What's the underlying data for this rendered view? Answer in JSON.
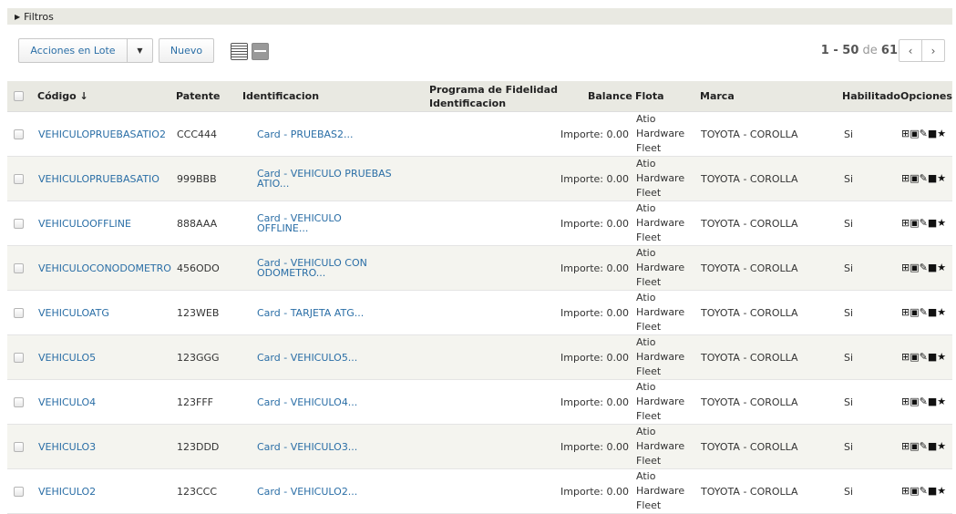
{
  "filters": {
    "label": "Filtros",
    "toggle_icon": "triangle-right-icon"
  },
  "toolbar": {
    "bulk_actions_label": "Acciones en Lote",
    "bulk_caret_icon": "caret-down-icon",
    "new_label": "Nuevo",
    "view_list_icon": "list-view-icon",
    "view_grid_icon": "grid-view-icon"
  },
  "pagination": {
    "range": "1 - 50",
    "of": "de",
    "total": "61",
    "prev_icon": "chevron-left-icon",
    "next_icon": "chevron-right-icon"
  },
  "table": {
    "headers": {
      "codigo": "Código ↓",
      "patente": "Patente",
      "identificacion": "Identificacion",
      "programa_line1": "Programa de Fidelidad",
      "programa_line2": "Identificacion",
      "balance": "Balance",
      "flota": "Flota",
      "marca": "Marca",
      "habilitado": "Habilitado",
      "opciones": "Opciones"
    },
    "rows": [
      {
        "codigo": "VEHICULOPRUEBASATIO2",
        "patente": "CCC444",
        "ident": "Card - PRUEBAS2...",
        "balance": "Importe: 0.00",
        "flota": [
          "Atio",
          "Hardware",
          "Fleet"
        ],
        "marca": "TOYOTA - COROLLA",
        "habilitado": "Si"
      },
      {
        "codigo": "VEHICULOPRUEBASATIO",
        "patente": "999BBB",
        "ident": "Card - VEHICULO PRUEBAS ATIO...",
        "balance": "Importe: 0.00",
        "flota": [
          "Atio",
          "Hardware",
          "Fleet"
        ],
        "marca": "TOYOTA - COROLLA",
        "habilitado": "Si"
      },
      {
        "codigo": "VEHICULOOFFLINE",
        "patente": "888AAA",
        "ident": "Card - VEHICULO OFFLINE...",
        "balance": "Importe: 0.00",
        "flota": [
          "Atio",
          "Hardware",
          "Fleet"
        ],
        "marca": "TOYOTA - COROLLA",
        "habilitado": "Si"
      },
      {
        "codigo": "VEHICULOCONODOMETRO",
        "patente": "456ODO",
        "ident": "Card - VEHICULO CON ODOMETRO...",
        "balance": "Importe: 0.00",
        "flota": [
          "Atio",
          "Hardware",
          "Fleet"
        ],
        "marca": "TOYOTA - COROLLA",
        "habilitado": "Si"
      },
      {
        "codigo": "VEHICULOATG",
        "patente": "123WEB",
        "ident": "Card - TARJETA ATG...",
        "balance": "Importe: 0.00",
        "flota": [
          "Atio",
          "Hardware",
          "Fleet"
        ],
        "marca": "TOYOTA - COROLLA",
        "habilitado": "Si"
      },
      {
        "codigo": "VEHICULO5",
        "patente": "123GGG",
        "ident": "Card - VEHICULO5...",
        "balance": "Importe: 0.00",
        "flota": [
          "Atio",
          "Hardware",
          "Fleet"
        ],
        "marca": "TOYOTA - COROLLA",
        "habilitado": "Si"
      },
      {
        "codigo": "VEHICULO4",
        "patente": "123FFF",
        "ident": "Card - VEHICULO4...",
        "balance": "Importe: 0.00",
        "flota": [
          "Atio",
          "Hardware",
          "Fleet"
        ],
        "marca": "TOYOTA - COROLLA",
        "habilitado": "Si"
      },
      {
        "codigo": "VEHICULO3",
        "patente": "123DDD",
        "ident": "Card - VEHICULO3...",
        "balance": "Importe: 0.00",
        "flota": [
          "Atio",
          "Hardware",
          "Fleet"
        ],
        "marca": "TOYOTA - COROLLA",
        "habilitado": "Si"
      },
      {
        "codigo": "VEHICULO2",
        "patente": "123CCC",
        "ident": "Card - VEHICULO2...",
        "balance": "Importe: 0.00",
        "flota": [
          "Atio",
          "Hardware",
          "Fleet"
        ],
        "marca": "TOYOTA - COROLLA",
        "habilitado": "Si"
      }
    ],
    "option_icons": [
      "split-icon",
      "comment-icon",
      "edit-icon",
      "lock-icon",
      "star-icon"
    ]
  },
  "colors": {
    "link": "#2a6ea6",
    "header_bg": "#e9e9e2",
    "alt_row_bg": "#f4f4ef"
  }
}
